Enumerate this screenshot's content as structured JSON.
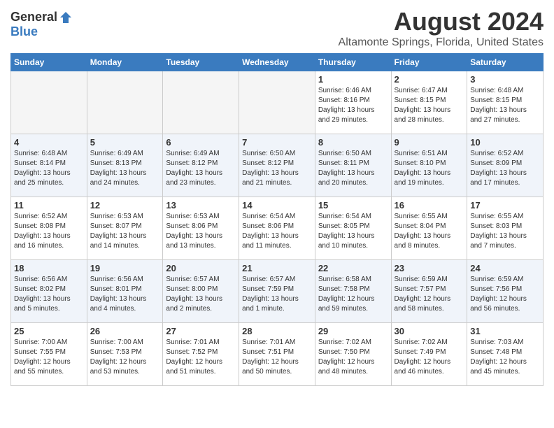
{
  "header": {
    "logo_general": "General",
    "logo_blue": "Blue",
    "main_title": "August 2024",
    "subtitle": "Altamonte Springs, Florida, United States"
  },
  "calendar": {
    "days_of_week": [
      "Sunday",
      "Monday",
      "Tuesday",
      "Wednesday",
      "Thursday",
      "Friday",
      "Saturday"
    ],
    "weeks": [
      [
        {
          "day": "",
          "info": "",
          "empty": true
        },
        {
          "day": "",
          "info": "",
          "empty": true
        },
        {
          "day": "",
          "info": "",
          "empty": true
        },
        {
          "day": "",
          "info": "",
          "empty": true
        },
        {
          "day": "1",
          "info": "Sunrise: 6:46 AM\nSunset: 8:16 PM\nDaylight: 13 hours\nand 29 minutes."
        },
        {
          "day": "2",
          "info": "Sunrise: 6:47 AM\nSunset: 8:15 PM\nDaylight: 13 hours\nand 28 minutes."
        },
        {
          "day": "3",
          "info": "Sunrise: 6:48 AM\nSunset: 8:15 PM\nDaylight: 13 hours\nand 27 minutes."
        }
      ],
      [
        {
          "day": "4",
          "info": "Sunrise: 6:48 AM\nSunset: 8:14 PM\nDaylight: 13 hours\nand 25 minutes."
        },
        {
          "day": "5",
          "info": "Sunrise: 6:49 AM\nSunset: 8:13 PM\nDaylight: 13 hours\nand 24 minutes."
        },
        {
          "day": "6",
          "info": "Sunrise: 6:49 AM\nSunset: 8:12 PM\nDaylight: 13 hours\nand 23 minutes."
        },
        {
          "day": "7",
          "info": "Sunrise: 6:50 AM\nSunset: 8:12 PM\nDaylight: 13 hours\nand 21 minutes."
        },
        {
          "day": "8",
          "info": "Sunrise: 6:50 AM\nSunset: 8:11 PM\nDaylight: 13 hours\nand 20 minutes."
        },
        {
          "day": "9",
          "info": "Sunrise: 6:51 AM\nSunset: 8:10 PM\nDaylight: 13 hours\nand 19 minutes."
        },
        {
          "day": "10",
          "info": "Sunrise: 6:52 AM\nSunset: 8:09 PM\nDaylight: 13 hours\nand 17 minutes."
        }
      ],
      [
        {
          "day": "11",
          "info": "Sunrise: 6:52 AM\nSunset: 8:08 PM\nDaylight: 13 hours\nand 16 minutes."
        },
        {
          "day": "12",
          "info": "Sunrise: 6:53 AM\nSunset: 8:07 PM\nDaylight: 13 hours\nand 14 minutes."
        },
        {
          "day": "13",
          "info": "Sunrise: 6:53 AM\nSunset: 8:06 PM\nDaylight: 13 hours\nand 13 minutes."
        },
        {
          "day": "14",
          "info": "Sunrise: 6:54 AM\nSunset: 8:06 PM\nDaylight: 13 hours\nand 11 minutes."
        },
        {
          "day": "15",
          "info": "Sunrise: 6:54 AM\nSunset: 8:05 PM\nDaylight: 13 hours\nand 10 minutes."
        },
        {
          "day": "16",
          "info": "Sunrise: 6:55 AM\nSunset: 8:04 PM\nDaylight: 13 hours\nand 8 minutes."
        },
        {
          "day": "17",
          "info": "Sunrise: 6:55 AM\nSunset: 8:03 PM\nDaylight: 13 hours\nand 7 minutes."
        }
      ],
      [
        {
          "day": "18",
          "info": "Sunrise: 6:56 AM\nSunset: 8:02 PM\nDaylight: 13 hours\nand 5 minutes."
        },
        {
          "day": "19",
          "info": "Sunrise: 6:56 AM\nSunset: 8:01 PM\nDaylight: 13 hours\nand 4 minutes."
        },
        {
          "day": "20",
          "info": "Sunrise: 6:57 AM\nSunset: 8:00 PM\nDaylight: 13 hours\nand 2 minutes."
        },
        {
          "day": "21",
          "info": "Sunrise: 6:57 AM\nSunset: 7:59 PM\nDaylight: 13 hours\nand 1 minute."
        },
        {
          "day": "22",
          "info": "Sunrise: 6:58 AM\nSunset: 7:58 PM\nDaylight: 12 hours\nand 59 minutes."
        },
        {
          "day": "23",
          "info": "Sunrise: 6:59 AM\nSunset: 7:57 PM\nDaylight: 12 hours\nand 58 minutes."
        },
        {
          "day": "24",
          "info": "Sunrise: 6:59 AM\nSunset: 7:56 PM\nDaylight: 12 hours\nand 56 minutes."
        }
      ],
      [
        {
          "day": "25",
          "info": "Sunrise: 7:00 AM\nSunset: 7:55 PM\nDaylight: 12 hours\nand 55 minutes."
        },
        {
          "day": "26",
          "info": "Sunrise: 7:00 AM\nSunset: 7:53 PM\nDaylight: 12 hours\nand 53 minutes."
        },
        {
          "day": "27",
          "info": "Sunrise: 7:01 AM\nSunset: 7:52 PM\nDaylight: 12 hours\nand 51 minutes."
        },
        {
          "day": "28",
          "info": "Sunrise: 7:01 AM\nSunset: 7:51 PM\nDaylight: 12 hours\nand 50 minutes."
        },
        {
          "day": "29",
          "info": "Sunrise: 7:02 AM\nSunset: 7:50 PM\nDaylight: 12 hours\nand 48 minutes."
        },
        {
          "day": "30",
          "info": "Sunrise: 7:02 AM\nSunset: 7:49 PM\nDaylight: 12 hours\nand 46 minutes."
        },
        {
          "day": "31",
          "info": "Sunrise: 7:03 AM\nSunset: 7:48 PM\nDaylight: 12 hours\nand 45 minutes."
        }
      ]
    ]
  }
}
